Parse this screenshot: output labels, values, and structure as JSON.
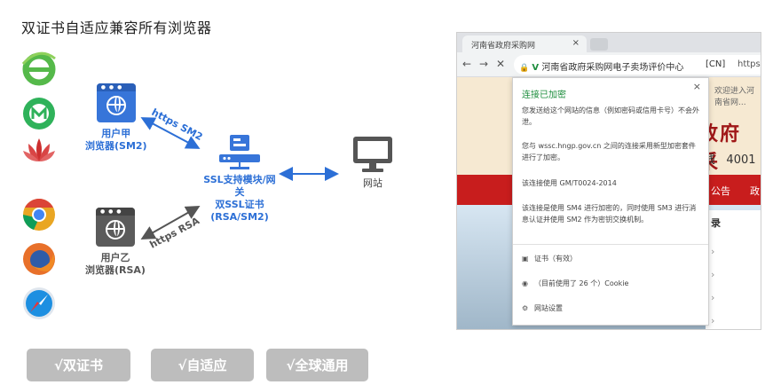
{
  "title": "双证书自适应兼容所有浏览器",
  "browsers": [
    {
      "icon": "ie-browser-icon",
      "color": "#55b94a"
    },
    {
      "icon": "360-browser-icon",
      "color": "#2fb25a"
    },
    {
      "icon": "lotus-browser-icon",
      "color": "#cc2f2f"
    },
    {
      "icon": "chrome-icon",
      "color": "#e9a623"
    },
    {
      "icon": "firefox-icon",
      "color": "#e8702a"
    },
    {
      "icon": "safari-icon",
      "color": "#1d8fe1"
    }
  ],
  "nodes": {
    "browser_a": {
      "line1": "用户甲",
      "line2": "浏览器(SM2)"
    },
    "browser_b": {
      "line1": "用户乙",
      "line2": "浏览器(RSA)"
    },
    "gateway": {
      "line1": "SSL支持模块/网关",
      "line2": "双SSL证书",
      "line3": "(RSA/SM2)"
    },
    "website": {
      "line1": "网站"
    }
  },
  "protocols": {
    "sm2": "https SM2",
    "rsa": "https RSA"
  },
  "features": [
    "√双证书",
    "√自适应",
    "√全球通用"
  ],
  "colors": {
    "accent": "#3775d9",
    "gray_node": "#5b5b5b",
    "pill": "#bdbdbd"
  },
  "screenshot": {
    "tab_title": "河南省政府采购网",
    "tab_close": "×",
    "nav": {
      "back": "←",
      "forward": "→",
      "reload": "✕"
    },
    "url_prefix": "V",
    "url_text": "河南省政府采购网电子卖场评价中心",
    "url_cn": "[CN]",
    "url_scheme": "https://",
    "site_top_text": "欢迎进入河南省网...",
    "site_heading": "政府采",
    "site_phone_prefix": "线",
    "site_phone": "4001",
    "site_nav": [
      "公告",
      "政"
    ],
    "site_panel_label": "录",
    "popup": {
      "close": "×",
      "heading": "连接已加密",
      "p1": "您发送给这个网站的信息（例如密码或信用卡号）不会外泄。",
      "p2": "您与 wssc.hngp.gov.cn 之间的连接采用新型加密套件进行了加密。",
      "p3": "该连接使用 GM/T0024-2014",
      "p4": "该连接是使用 SM4 进行加密的，同时使用 SM3 进行消息认证并使用 SM2 作为密钥交换机制。",
      "cert": "证书（有效）",
      "cookie": "（目前使用了 26 个）Cookie",
      "settings": "网站设置"
    }
  }
}
